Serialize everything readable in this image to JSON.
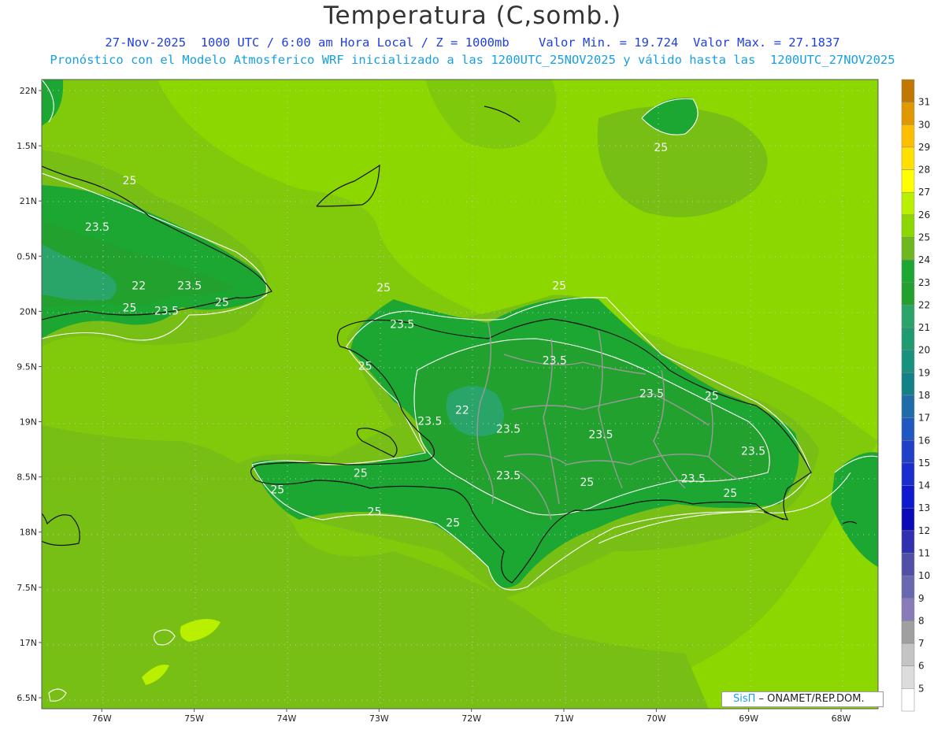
{
  "header": {
    "title": "Temperatura (C,somb.)",
    "line1": "27-Nov-2025  1000 UTC / 6:00 am Hora Local / Z = 1000mb    Valor Min. = 19.724  Valor Max. = 27.1837",
    "line2": "Pronóstico con el Modelo Atmosferico WRF inicializado a las 1200UTC_25NOV2025 y válido hasta las  1200UTC_27NOV2025"
  },
  "axes": {
    "lat_labels": [
      "22N",
      "1.5N",
      "21N",
      "0.5N",
      "20N",
      "9.5N",
      "19N",
      "8.5N",
      "18N",
      "7.5N",
      "17N",
      "6.5N"
    ],
    "lat_values": [
      22,
      21.5,
      21,
      20.5,
      20,
      19.5,
      19,
      18.5,
      18,
      17.5,
      17,
      16.5
    ],
    "lon_labels": [
      "76W",
      "75W",
      "74W",
      "73W",
      "72W",
      "71W",
      "70W",
      "69W",
      "68W"
    ],
    "lon_values": [
      -76,
      -75,
      -74,
      -73,
      -72,
      -71,
      -70,
      -69,
      -68
    ],
    "lat_range": [
      16.4,
      22.1
    ],
    "lon_range": [
      -76.65,
      -67.6
    ]
  },
  "colorbar": {
    "levels": [
      "31",
      "30",
      "29",
      "28",
      "27",
      "26",
      "25",
      "24",
      "23",
      "22",
      "21",
      "20",
      "19",
      "18",
      "17",
      "16",
      "15",
      "14",
      "13",
      "12",
      "11",
      "10",
      "9",
      "8",
      "7",
      "6",
      "5"
    ],
    "colors": [
      "#c07800",
      "#e09800",
      "#ffbf00",
      "#ffe000",
      "#ffff00",
      "#b8f000",
      "#8cd700",
      "#6fb71e",
      "#1ca733",
      "#22a12f",
      "#2aa56a",
      "#1f9a72",
      "#17927f",
      "#148088",
      "#1e6ca8",
      "#1f58c0",
      "#2040c8",
      "#1a2ed0",
      "#0f1ad0",
      "#0a0ab8",
      "#3030b0",
      "#5050a8",
      "#6868b0",
      "#8a7ab8",
      "#a0a0a0",
      "#c4c4c4",
      "#dcdcdc",
      "#ffffff"
    ]
  },
  "contour_labels": [
    {
      "text": "25",
      "lat": 21.15,
      "lon": -75.7
    },
    {
      "text": "23.5",
      "lat": 20.73,
      "lon": -76.05
    },
    {
      "text": "22",
      "lat": 20.2,
      "lon": -75.6
    },
    {
      "text": "23.5",
      "lat": 20.2,
      "lon": -75.05
    },
    {
      "text": "25",
      "lat": 20.0,
      "lon": -75.7
    },
    {
      "text": "23.5",
      "lat": 19.97,
      "lon": -75.3
    },
    {
      "text": "25",
      "lat": 20.05,
      "lon": -74.7
    },
    {
      "text": "25",
      "lat": 20.18,
      "lon": -72.95
    },
    {
      "text": "23.5",
      "lat": 19.85,
      "lon": -72.75
    },
    {
      "text": "25",
      "lat": 19.47,
      "lon": -73.15
    },
    {
      "text": "23.5",
      "lat": 18.97,
      "lon": -72.45
    },
    {
      "text": "22",
      "lat": 19.07,
      "lon": -72.1
    },
    {
      "text": "23.5",
      "lat": 18.9,
      "lon": -71.6
    },
    {
      "text": "25",
      "lat": 20.2,
      "lon": -71.05
    },
    {
      "text": "23.5",
      "lat": 19.52,
      "lon": -71.1
    },
    {
      "text": "23.5",
      "lat": 19.22,
      "lon": -70.05
    },
    {
      "text": "25",
      "lat": 19.2,
      "lon": -69.4
    },
    {
      "text": "23.5",
      "lat": 18.85,
      "lon": -70.6
    },
    {
      "text": "23.5",
      "lat": 18.48,
      "lon": -71.6
    },
    {
      "text": "25",
      "lat": 18.42,
      "lon": -70.75
    },
    {
      "text": "23.5",
      "lat": 18.45,
      "lon": -69.6
    },
    {
      "text": "23.5",
      "lat": 18.7,
      "lon": -68.95
    },
    {
      "text": "25",
      "lat": 18.32,
      "lon": -69.2
    },
    {
      "text": "25",
      "lat": 18.5,
      "lon": -73.2
    },
    {
      "text": "25",
      "lat": 18.35,
      "lon": -74.1
    },
    {
      "text": "25",
      "lat": 18.15,
      "lon": -73.05
    },
    {
      "text": "25",
      "lat": 18.05,
      "lon": -72.2
    },
    {
      "text": "25",
      "lat": 21.45,
      "lon": -69.95
    }
  ],
  "credit": {
    "brand": "SisΠ",
    "text": " – ONAMET/REP.DOM."
  }
}
